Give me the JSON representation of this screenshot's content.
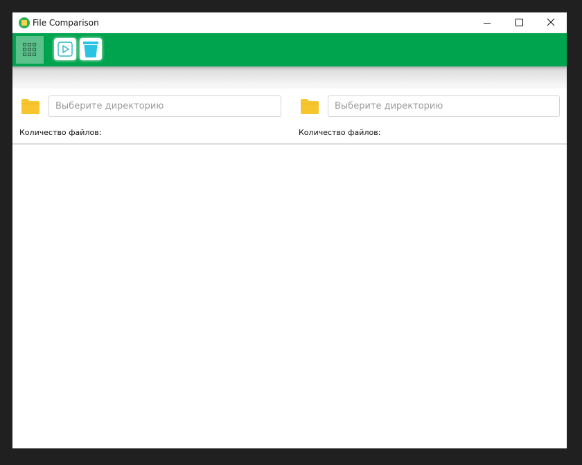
{
  "window": {
    "title": "File Comparison",
    "icon": "app-icon"
  },
  "toolbar": {
    "buttons": [
      {
        "name": "apps-grid-icon",
        "active": true
      },
      {
        "name": "play-icon"
      },
      {
        "name": "trash-icon"
      }
    ],
    "accent_color": "#00a44e"
  },
  "panels": {
    "left": {
      "input_placeholder": "Выберите директорию",
      "input_value": "",
      "count_label": "Количество файлов:"
    },
    "right": {
      "input_placeholder": "Выберите директорию",
      "input_value": "",
      "count_label": "Количество файлов:"
    }
  },
  "colors": {
    "folder": "#f7c62f",
    "play_icon": "#2bb6c9",
    "trash_icon": "#2bc3e3"
  }
}
